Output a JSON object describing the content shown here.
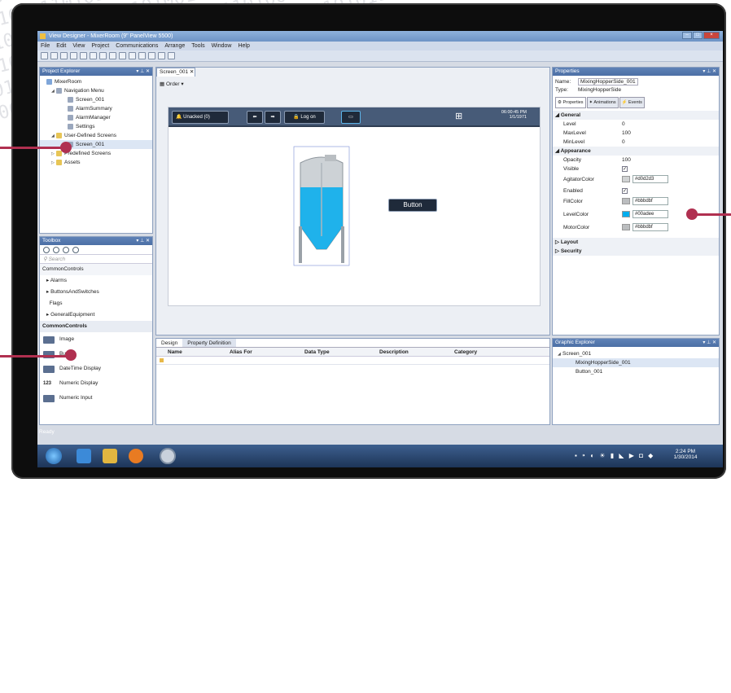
{
  "window": {
    "title": "View Designer - MixerRoom (9\" PanelView 5500)"
  },
  "menu": [
    "File",
    "Edit",
    "View",
    "Project",
    "Communications",
    "Arrange",
    "Tools",
    "Window",
    "Help"
  ],
  "project_explorer": {
    "title": "Project Explorer",
    "items": [
      "MixerRoom",
      "Navigation Menu",
      "Screen_001",
      "AlarmSummary",
      "AlarmManager",
      "Settings",
      "User-Defined Screens",
      "Screen_001",
      "Predefined Screens",
      "Assets"
    ]
  },
  "toolbox": {
    "title": "Toolbox",
    "search_placeholder": "Search",
    "categories": [
      "CommonControls",
      "Alarms",
      "ButtonsAndSwitches",
      "Flags",
      "GeneralEquipment"
    ],
    "section": "CommonControls",
    "tools": [
      "Image",
      "Button",
      "DateTime Display",
      "Numeric Display",
      "Numeric Input"
    ]
  },
  "document": {
    "tab": "Screen_001",
    "order_label": "Order",
    "hmi": {
      "alarm_label": "Unacked (0)",
      "logon_label": "Log on",
      "time": "06:00:45 PM",
      "date": "1/1/1971"
    },
    "button_label": "Button"
  },
  "bottom": {
    "tabs": [
      "Design",
      "Property Definition"
    ],
    "columns": [
      "Name",
      "Alias For",
      "Data Type",
      "Description",
      "Category"
    ]
  },
  "properties": {
    "title": "Properties",
    "name_label": "Name:",
    "name_value": "MixingHopperSide_001",
    "type_label": "Type:",
    "type_value": "MixingHopperSide",
    "tabs": [
      "Properties",
      "Animations",
      "Events"
    ],
    "general": {
      "label": "General",
      "rows": [
        {
          "k": "Level",
          "v": "0"
        },
        {
          "k": "MaxLevel",
          "v": "100"
        },
        {
          "k": "MinLevel",
          "v": "0"
        }
      ]
    },
    "appearance": {
      "label": "Appearance",
      "opacity_k": "Opacity",
      "opacity_v": "100",
      "visible_k": "Visible",
      "agitator_k": "AgitatorColor",
      "agitator_v": "#d0d2d3",
      "enabled_k": "Enabled",
      "fill_k": "FillColor",
      "fill_v": "#bbbdbf",
      "level_k": "LevelColor",
      "level_v": "#00adee",
      "motor_k": "MotorColor",
      "motor_v": "#bbbdbf"
    },
    "layout": "Layout",
    "security": "Security"
  },
  "graphic_explorer": {
    "title": "Graphic Explorer",
    "items": [
      "Screen_001",
      "MixingHopperSide_001",
      "Button_001"
    ]
  },
  "status": "Ready",
  "clock": {
    "time": "2:24 PM",
    "date": "1/30/2014"
  },
  "colors": {
    "level": "#00adee",
    "callout": "#b03050"
  }
}
